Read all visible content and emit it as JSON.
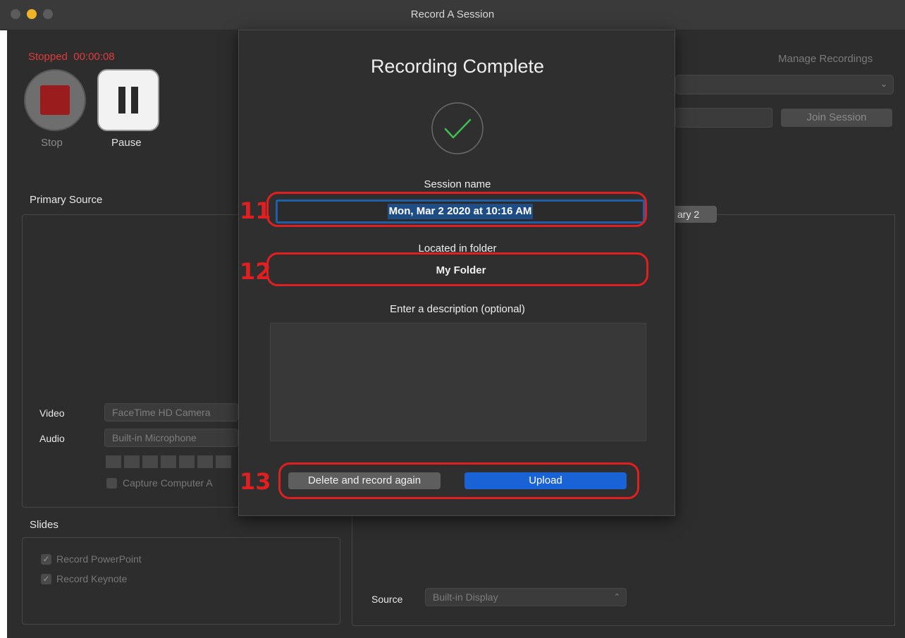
{
  "window": {
    "title": "Record A Session"
  },
  "recorder": {
    "status": "Stopped",
    "timer": "00:00:08",
    "stop_label": "Stop",
    "pause_label": "Pause"
  },
  "right_top": {
    "manage_recordings": "Manage Recordings",
    "join_session": "Join Session",
    "secondary_tab": "ary 2"
  },
  "primary_source": {
    "title": "Primary Source",
    "video_label": "Video",
    "video_value": "FaceTime HD Camera",
    "audio_label": "Audio",
    "audio_value": "Built-in Microphone",
    "capture_audio": "Capture Computer A"
  },
  "slides": {
    "title": "Slides",
    "items": [
      "Record PowerPoint",
      "Record Keynote"
    ]
  },
  "secondary_source": {
    "source_label": "Source",
    "source_value": "Built-in Display"
  },
  "modal": {
    "heading": "Recording Complete",
    "session_name_label": "Session name",
    "session_name_value": "Mon, Mar 2 2020 at 10:16 AM",
    "folder_label": "Located in folder",
    "folder_value": "My Folder",
    "description_label": "Enter a description (optional)",
    "description_value": "",
    "delete_button": "Delete and record again",
    "upload_button": "Upload"
  },
  "annotations": [
    "11",
    "12",
    "13"
  ],
  "colors": {
    "accent_blue": "#1a63d6",
    "annotation_red": "#e02020",
    "status_red": "#e23b3b",
    "check_green": "#3fbf4f"
  }
}
